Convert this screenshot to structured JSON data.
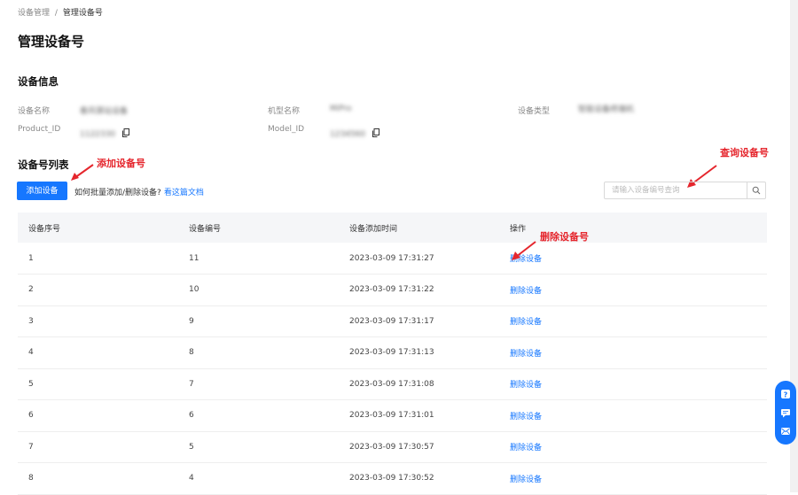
{
  "breadcrumb": {
    "parent": "设备管理",
    "separator": "/",
    "current": "管理设备号"
  },
  "page_title": "管理设备号",
  "device_info": {
    "title": "设备信息",
    "fields": {
      "device_name": {
        "label": "设备名称",
        "value": "春风驿站设备"
      },
      "model_name": {
        "label": "机型名称",
        "value": "MiPro"
      },
      "device_type": {
        "label": "设备类型",
        "value": "智能设备终端机"
      },
      "product_id": {
        "label": "Product_ID",
        "value": "1122330"
      },
      "model_id": {
        "label": "Model_ID",
        "value": "1234560"
      }
    }
  },
  "device_list": {
    "title": "设备号列表",
    "add_button": "添加设备",
    "hint_text": "如何批量添加/删除设备?",
    "hint_link": "看这篇文档",
    "search_placeholder": "请输入设备编号查询",
    "columns": [
      "设备序号",
      "设备编号",
      "设备添加时间",
      "操作"
    ],
    "rows": [
      {
        "index": "1",
        "number": "11",
        "time": "2023-03-09 17:31:27",
        "action": "删除设备"
      },
      {
        "index": "2",
        "number": "10",
        "time": "2023-03-09 17:31:22",
        "action": "删除设备"
      },
      {
        "index": "3",
        "number": "9",
        "time": "2023-03-09 17:31:17",
        "action": "删除设备"
      },
      {
        "index": "4",
        "number": "8",
        "time": "2023-03-09 17:31:13",
        "action": "删除设备"
      },
      {
        "index": "5",
        "number": "7",
        "time": "2023-03-09 17:31:08",
        "action": "删除设备"
      },
      {
        "index": "6",
        "number": "6",
        "time": "2023-03-09 17:31:01",
        "action": "删除设备"
      },
      {
        "index": "7",
        "number": "5",
        "time": "2023-03-09 17:30:57",
        "action": "删除设备"
      },
      {
        "index": "8",
        "number": "4",
        "time": "2023-03-09 17:30:52",
        "action": "删除设备"
      }
    ]
  },
  "annotations": {
    "add": "添加设备号",
    "query": "查询设备号",
    "delete": "删除设备号"
  },
  "colors": {
    "primary": "#1677ff",
    "annotation": "#e5262d"
  },
  "float_panel": {
    "icons": [
      "help-icon",
      "chat-icon",
      "feedback-icon"
    ]
  }
}
